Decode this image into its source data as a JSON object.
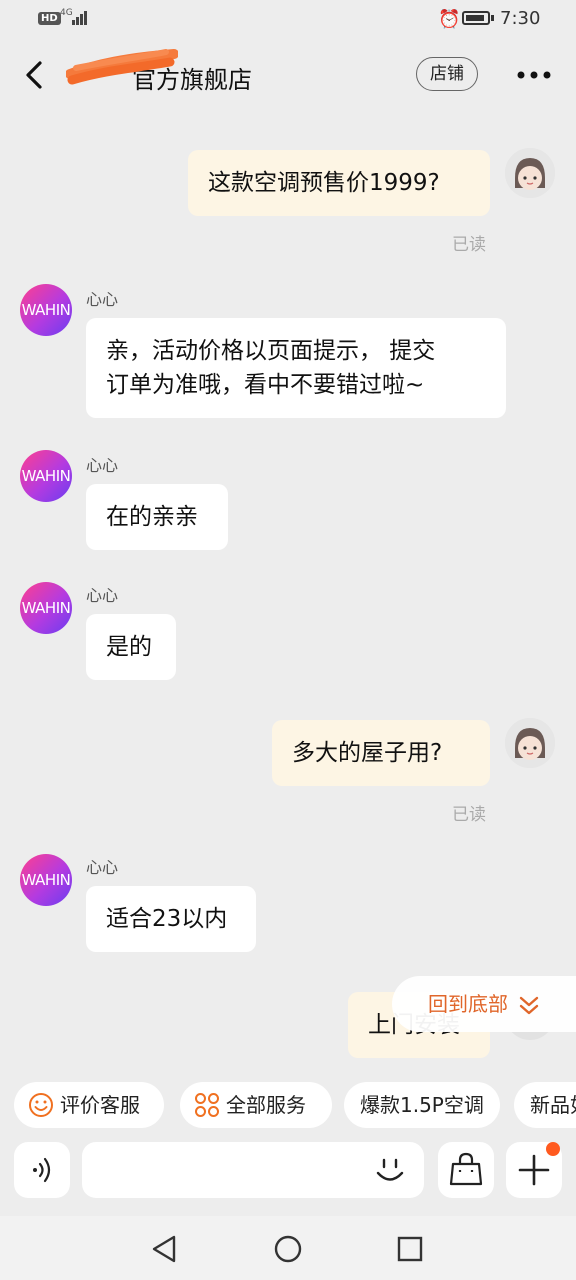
{
  "status_bar": {
    "hd": "HD",
    "network": "4G",
    "time": "7:30"
  },
  "header": {
    "title": "官方旗舰店",
    "shop_button": "店铺"
  },
  "messages": [
    {
      "from": "user",
      "text": "这款空调预售价1999?",
      "status": "已读"
    },
    {
      "from": "shop",
      "sender": "心心",
      "avatar": "WAHIN",
      "lines": [
        "亲，活动价格以页面提示， 提交",
        "订单为准哦，看中不要错过啦~"
      ]
    },
    {
      "from": "shop",
      "sender": "心心",
      "avatar": "WAHIN",
      "text": "在的亲亲"
    },
    {
      "from": "shop",
      "sender": "心心",
      "avatar": "WAHIN",
      "text": "是的"
    },
    {
      "from": "user",
      "text": "多大的屋子用?",
      "status": "已读"
    },
    {
      "from": "shop",
      "sender": "心心",
      "avatar": "WAHIN",
      "text": "适合23以内"
    },
    {
      "from": "user",
      "text": "上门安装"
    }
  ],
  "back_to_bottom": "回到底部",
  "quick_chips": [
    {
      "icon": "smile-icon",
      "label": "评价客服"
    },
    {
      "icon": "grid-icon",
      "label": "全部服务"
    },
    {
      "icon": "",
      "label": "爆款1.5P空调"
    },
    {
      "icon": "",
      "label": "新品如"
    }
  ],
  "input_bar": {
    "voice_icon": "voice-icon",
    "emoji_icon": "emoji-icon",
    "bag_icon": "shopping-bag-icon",
    "plus_icon": "plus-icon",
    "badge_color": "#ff5a1f"
  },
  "nav_bar": {
    "back": "triangle-back-icon",
    "home": "circle-home-icon",
    "recent": "square-recent-icon"
  },
  "colors": {
    "outgoing_bubble": "#fdf5e4",
    "incoming_bubble": "#ffffff",
    "accent": "#e0662a",
    "background": "#ededed"
  }
}
